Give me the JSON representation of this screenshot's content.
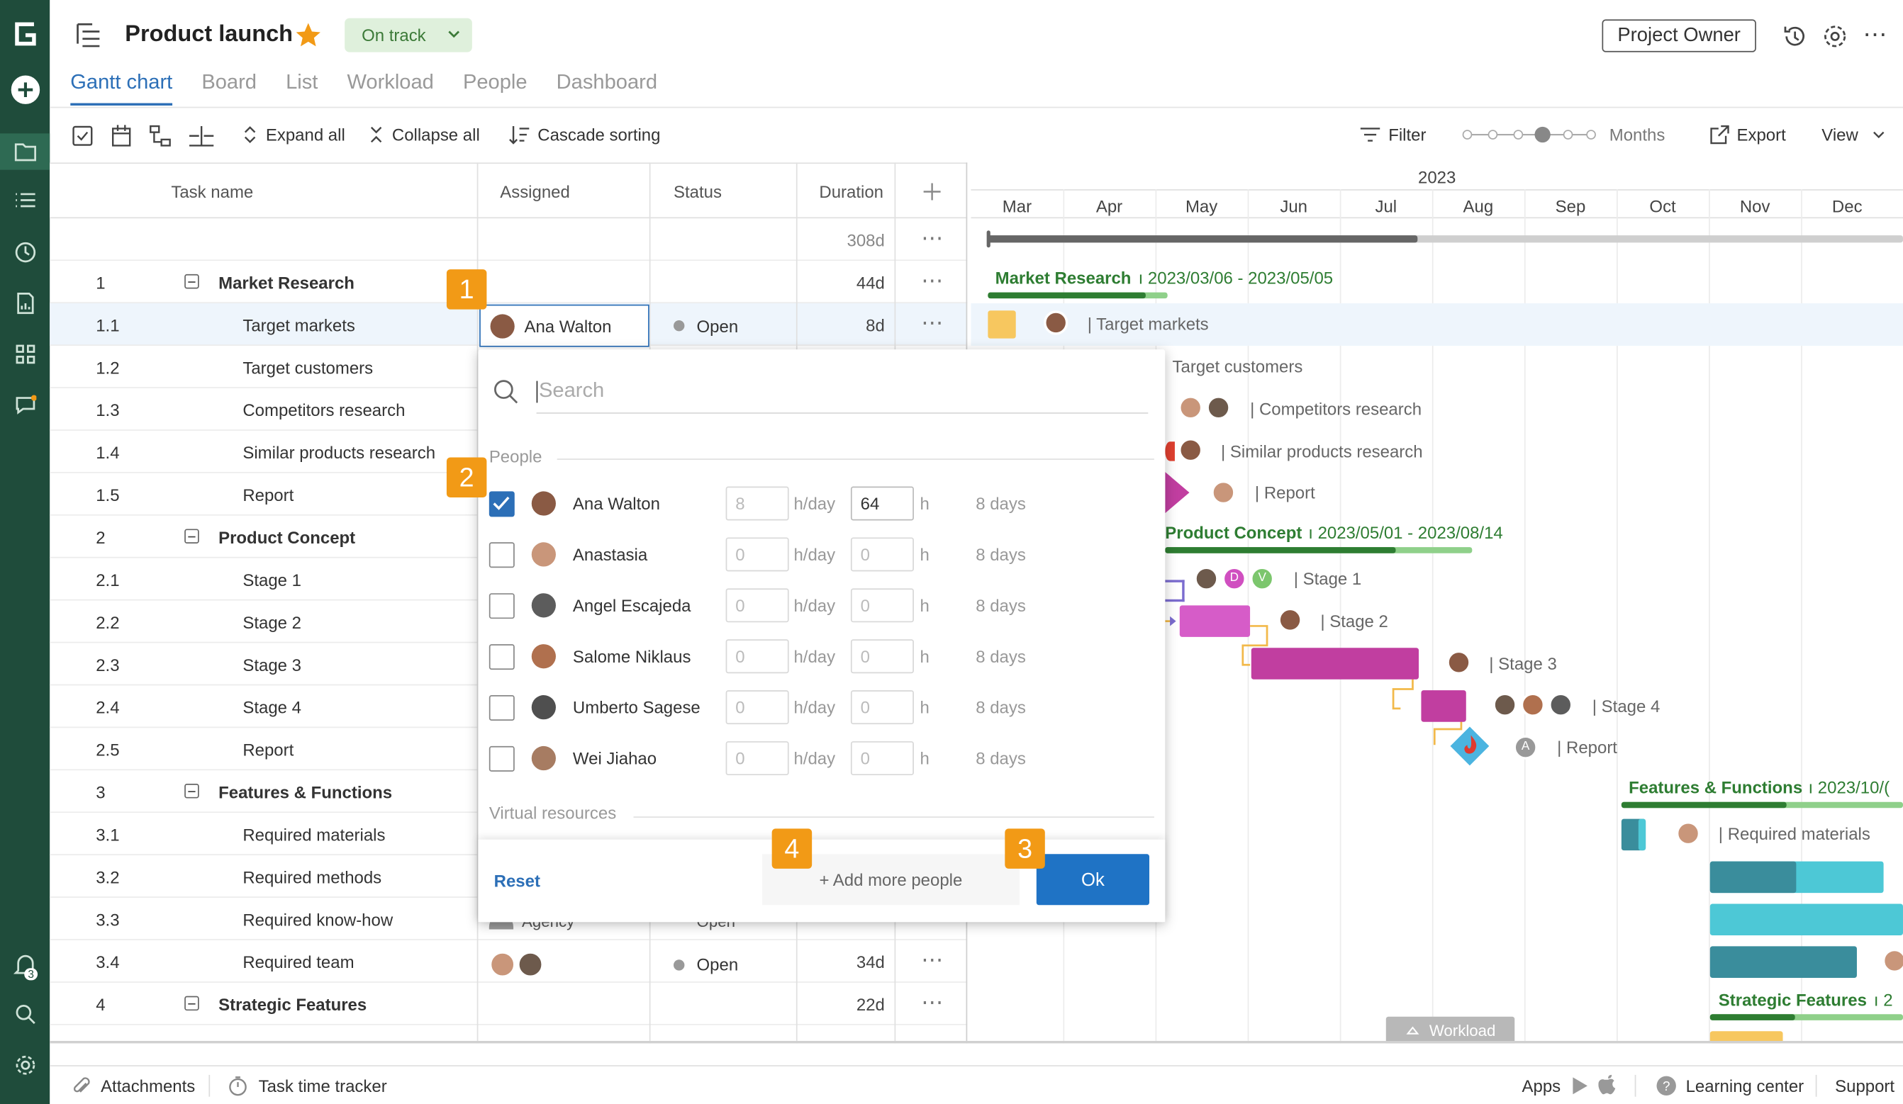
{
  "header": {
    "title": "Product launch",
    "status": "On track",
    "owner_button": "Project Owner"
  },
  "tabs": [
    "Gantt chart",
    "Board",
    "List",
    "Workload",
    "People",
    "Dashboard"
  ],
  "toolbar": {
    "expand_all": "Expand all",
    "collapse_all": "Collapse all",
    "cascade_sorting": "Cascade sorting",
    "filter": "Filter",
    "zoom_label": "Months",
    "zoom_level": 0.6,
    "export": "Export",
    "view": "View"
  },
  "grid": {
    "columns": [
      "Task name",
      "Assigned",
      "Status",
      "Duration"
    ],
    "total_duration": "308d",
    "rows": [
      {
        "num": "1",
        "name": "Market Research",
        "group": true,
        "duration": "44d"
      },
      {
        "num": "1.1",
        "name": "Target markets",
        "assigned": "Ana Walton",
        "status": "Open",
        "duration": "8d"
      },
      {
        "num": "1.2",
        "name": "Target customers"
      },
      {
        "num": "1.3",
        "name": "Competitors research"
      },
      {
        "num": "1.4",
        "name": "Similar products research"
      },
      {
        "num": "1.5",
        "name": "Report"
      },
      {
        "num": "2",
        "name": "Product Concept",
        "group": true
      },
      {
        "num": "2.1",
        "name": "Stage 1"
      },
      {
        "num": "2.2",
        "name": "Stage 2"
      },
      {
        "num": "2.3",
        "name": "Stage 3"
      },
      {
        "num": "2.4",
        "name": "Stage 4"
      },
      {
        "num": "2.5",
        "name": "Report"
      },
      {
        "num": "3",
        "name": "Features & Functions",
        "group": true
      },
      {
        "num": "3.1",
        "name": "Required materials"
      },
      {
        "num": "3.2",
        "name": "Required methods"
      },
      {
        "num": "3.3",
        "name": "Required know-how",
        "assigned": "Agency",
        "status": "Open"
      },
      {
        "num": "3.4",
        "name": "Required team",
        "status": "Open",
        "duration": "34d"
      },
      {
        "num": "4",
        "name": "Strategic Features",
        "group": true,
        "duration": "22d"
      }
    ]
  },
  "gantt": {
    "year": "2023",
    "months": [
      "Mar",
      "Apr",
      "May",
      "Jun",
      "Jul",
      "Aug",
      "Sep",
      "Oct",
      "Nov",
      "Dec"
    ],
    "groups": [
      {
        "name": "Market Research",
        "dates": "2023/03/06 - 2023/05/05"
      },
      {
        "name": "Product Concept",
        "dates": "2023/05/01 - 2023/08/14"
      },
      {
        "name": "Features & Functions",
        "dates": "2023/10/("
      },
      {
        "name": "Strategic Features",
        "dates": "2"
      }
    ],
    "tasks": [
      "Target markets",
      "Target customers",
      "Competitors research",
      "Similar products research",
      "Report",
      "Stage 1",
      "Stage 2",
      "Stage 3",
      "Stage 4",
      "Report",
      "Required materials"
    ],
    "avatar_initials": [
      "D",
      "V",
      "A"
    ],
    "workload_tab": "Workload"
  },
  "popup": {
    "search_placeholder": "Search",
    "people_label": "People",
    "virtual_label": "Virtual resources",
    "people": [
      {
        "name": "Ana Walton",
        "checked": true,
        "hday": "8",
        "h": "64",
        "days": "8 days"
      },
      {
        "name": "Anastasia",
        "checked": false,
        "hday": "0",
        "h": "0",
        "days": "8 days"
      },
      {
        "name": "Angel Escajeda",
        "checked": false,
        "hday": "0",
        "h": "0",
        "days": "8 days"
      },
      {
        "name": "Salome Niklaus",
        "checked": false,
        "hday": "0",
        "h": "0",
        "days": "8 days"
      },
      {
        "name": "Umberto Sagese",
        "checked": false,
        "hday": "0",
        "h": "0",
        "days": "8 days"
      },
      {
        "name": "Wei Jiahao",
        "checked": false,
        "hday": "0",
        "h": "0",
        "days": "8 days"
      }
    ],
    "hday_unit": "h/day",
    "h_unit": "h",
    "reset": "Reset",
    "add_more": "+ Add more people",
    "ok": "Ok"
  },
  "badges": [
    "1",
    "2",
    "3",
    "4"
  ],
  "footer": {
    "attachments": "Attachments",
    "time_tracker": "Task time tracker",
    "apps": "Apps",
    "learning": "Learning center",
    "support": "Support",
    "notif_count": "3"
  },
  "colors": {
    "rail": "#1f4c3b",
    "accent": "#2c6fb7",
    "badge": "#f29a16",
    "concept_bar": "#c13ea0",
    "features_bar": "#3a8d9c"
  }
}
